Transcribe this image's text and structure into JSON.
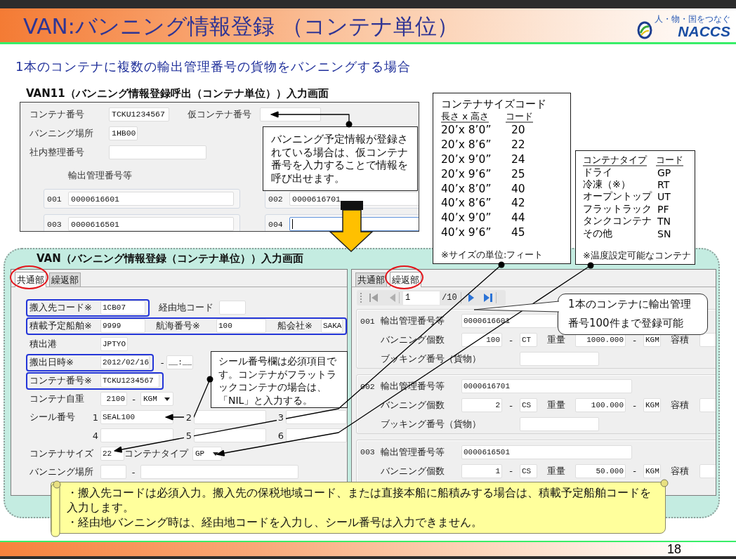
{
  "header": {
    "title": "VAN:バンニング情報登録 （コンテナ単位）",
    "logo": {
      "tagline": "人・物・国をつなぐ",
      "name": "NACCS"
    }
  },
  "subtitle": "1本のコンテナに複数の輸出管理番号の貨物をバンニングする場合",
  "call_screen": {
    "title": "VAN11（バンニング情報登録呼出（コンテナ単位））入力画面",
    "rows": [
      [
        {
          "label": "コンテナ番号",
          "value": "TCKU1234567"
        },
        {
          "label": "仮コンテナ番号"
        }
      ],
      [
        {
          "label": "バンニング場所",
          "value": "1HB00"
        }
      ],
      [
        {
          "label": "社内整理番号"
        }
      ]
    ],
    "export_label": "輸出管理番号等",
    "export_numbers": [
      {
        "index": "001",
        "value": "0000616601",
        "focused": false
      },
      {
        "index": "002",
        "value": "0000616701",
        "focused": false
      },
      {
        "index": "003",
        "value": "0000616501",
        "focused": false
      },
      {
        "index": "004",
        "focused": true
      }
    ]
  },
  "recall_callout": "バンニング予定情報が登録されている場合は、仮コンテナ番号を入力することで情報を呼び出せます。",
  "size_codes": {
    "title": "コンテナサイズコード",
    "columns": [
      "長さ x 高さ",
      "コード"
    ],
    "rows": [
      [
        "20’x 8’0”",
        "20"
      ],
      [
        "20’x 8’6”",
        "22"
      ],
      [
        "20’x 9’0”",
        "24"
      ],
      [
        "20’x 9’6”",
        "25"
      ],
      [
        "40’x 8’0”",
        "40"
      ],
      [
        "40’x 8’6”",
        "42"
      ],
      [
        "40’x 9’0”",
        "44"
      ],
      [
        "40’x 9’6”",
        "45"
      ]
    ],
    "note": "※サイズの単位:フィート"
  },
  "type_codes": {
    "columns": [
      "コンテナタイプ",
      "コード"
    ],
    "rows": [
      [
        "ドライ",
        "GP"
      ],
      [
        "冷凍（※）",
        "RT"
      ],
      [
        "オープントップ",
        "UT"
      ],
      [
        "フラットラック",
        "PF"
      ],
      [
        "タンクコンテナ",
        "TN"
      ],
      [
        "その他",
        "SN"
      ]
    ],
    "note": "※温度設定可能なコンテナ"
  },
  "entry_screen": {
    "title": "VAN（バンニング情報登録（コンテナ単位））入力画面",
    "common_window": {
      "tabs": [
        {
          "label": "共通部",
          "selected": true,
          "circled": true
        },
        {
          "label": "繰返部",
          "selected": false,
          "circled": false
        }
      ],
      "rows": [
        [
          {
            "kind": "group",
            "items": [
              {
                "kind": "label",
                "text": "搬入先コード※"
              },
              {
                "kind": "input",
                "value": "1CB07"
              }
            ]
          },
          {
            "kind": "label",
            "text": "経由地コード"
          },
          {
            "kind": "input"
          }
        ],
        [
          {
            "kind": "group",
            "items": [
              {
                "kind": "label",
                "text": "積載予定船舶※"
              },
              {
                "kind": "input",
                "value": "9999"
              },
              {
                "kind": "label",
                "text": "航海番号※"
              },
              {
                "kind": "input",
                "value": "100"
              },
              {
                "kind": "label",
                "text": "船会社※"
              },
              {
                "kind": "input",
                "value": "SAKA"
              }
            ]
          }
        ],
        [
          {
            "kind": "label",
            "text": "積出港"
          },
          {
            "kind": "input",
            "value": "JPTYO"
          }
        ],
        [
          {
            "kind": "group",
            "items": [
              {
                "kind": "label",
                "text": "搬出日時※"
              },
              {
                "kind": "input",
                "value": "2012/02/16"
              }
            ]
          },
          {
            "kind": "dash",
            "text": "-"
          },
          {
            "kind": "input",
            "value": "__:__"
          }
        ],
        [
          {
            "kind": "group",
            "items": [
              {
                "kind": "label",
                "text": "コンテナ番号※"
              },
              {
                "kind": "input",
                "value": "TCKU1234567"
              }
            ]
          }
        ],
        [
          {
            "kind": "label",
            "text": "コンテナ自重"
          },
          {
            "kind": "number",
            "value": "2100"
          },
          {
            "kind": "dash",
            "text": "-"
          },
          {
            "kind": "select",
            "value": "KGM"
          }
        ],
        [
          {
            "kind": "label",
            "text": "シール番号"
          },
          {
            "kind": "index",
            "text": "1"
          },
          {
            "kind": "input",
            "value": "SEAL100"
          },
          {
            "kind": "index",
            "text": "2"
          },
          {
            "kind": "input"
          },
          {
            "kind": "index",
            "text": "3"
          },
          {
            "kind": "input"
          }
        ],
        [
          {
            "kind": "index",
            "text": "4"
          },
          {
            "kind": "input"
          },
          {
            "kind": "index",
            "text": "5"
          },
          {
            "kind": "input"
          },
          {
            "kind": "index",
            "text": "6"
          },
          {
            "kind": "input"
          }
        ],
        [
          {
            "kind": "label",
            "text": "コンテナサイズ"
          },
          {
            "kind": "input",
            "value": "22"
          },
          {
            "kind": "label",
            "text": "コンテナタイプ"
          },
          {
            "kind": "select",
            "value": "GP"
          }
        ],
        [
          {
            "kind": "label",
            "text": "バンニング場所"
          },
          {
            "kind": "input"
          },
          {
            "kind": "dash",
            "text": "-"
          },
          {
            "kind": "input"
          }
        ]
      ]
    },
    "repeat_window": {
      "tabs": [
        {
          "label": "共通部",
          "selected": false,
          "circled": false
        },
        {
          "label": "繰返部",
          "selected": true,
          "circled": true
        }
      ],
      "pager": {
        "page": "1",
        "total": "/10"
      },
      "records": [
        {
          "index": "001",
          "rows": [
            [
              {
                "kind": "label",
                "text": "輸出管理番号等"
              },
              {
                "kind": "input",
                "value": "0000616601"
              }
            ],
            [
              {
                "kind": "label",
                "text": "バンニング個数"
              },
              {
                "kind": "number",
                "value": "100"
              },
              {
                "kind": "dash",
                "text": "-"
              },
              {
                "kind": "input",
                "value": "CT"
              },
              {
                "kind": "label",
                "text": "重量"
              },
              {
                "kind": "number",
                "value": "1000.000"
              },
              {
                "kind": "dash",
                "text": "-"
              },
              {
                "kind": "input",
                "value": "KGM"
              },
              {
                "kind": "label",
                "text": "容積"
              },
              {
                "kind": "input"
              }
            ],
            [
              {
                "kind": "label",
                "text": "ブッキング番号（貨物）"
              },
              {
                "kind": "input"
              }
            ]
          ]
        },
        {
          "index": "002",
          "rows": [
            [
              {
                "kind": "label",
                "text": "輸出管理番号等"
              },
              {
                "kind": "input",
                "value": "0000616701"
              }
            ],
            [
              {
                "kind": "label",
                "text": "バンニング個数"
              },
              {
                "kind": "number",
                "value": "2"
              },
              {
                "kind": "dash",
                "text": "-"
              },
              {
                "kind": "input",
                "value": "CS"
              },
              {
                "kind": "label",
                "text": "重量"
              },
              {
                "kind": "number",
                "value": "100.000"
              },
              {
                "kind": "dash",
                "text": "-"
              },
              {
                "kind": "input",
                "value": "KGM"
              },
              {
                "kind": "label",
                "text": "容積"
              },
              {
                "kind": "input"
              }
            ],
            [
              {
                "kind": "label",
                "text": "ブッキング番号（貨物）"
              },
              {
                "kind": "input"
              }
            ]
          ]
        },
        {
          "index": "003",
          "rows": [
            [
              {
                "kind": "label",
                "text": "輸出管理番号等"
              },
              {
                "kind": "input",
                "value": "0000616501"
              }
            ],
            [
              {
                "kind": "label",
                "text": "バンニング個数"
              },
              {
                "kind": "number",
                "value": "1"
              },
              {
                "kind": "dash",
                "text": "-"
              },
              {
                "kind": "input",
                "value": "CS"
              },
              {
                "kind": "label",
                "text": "重量"
              },
              {
                "kind": "number",
                "value": "50.000"
              },
              {
                "kind": "dash",
                "text": "-"
              },
              {
                "kind": "input",
                "value": "KGM"
              },
              {
                "kind": "label",
                "text": "容積"
              },
              {
                "kind": "input"
              }
            ]
          ]
        }
      ]
    }
  },
  "seal_callout": "シール番号欄は必須項目です。コンテナがフラットラックコンテナの場合は、「NIL」と入力する。",
  "limit_callout": "1本のコンテナに輸出管理番号100件まで登録可能",
  "bottom_note": [
    "・搬入先コードは必須入力。搬入先の保税地域コード、または直接本船に船積みする場合は、積載予定船舶コードを入力します。",
    "・経由地バンニング時は、経由地コードを入力し、シール番号は入力できません。"
  ],
  "page_number": "18"
}
